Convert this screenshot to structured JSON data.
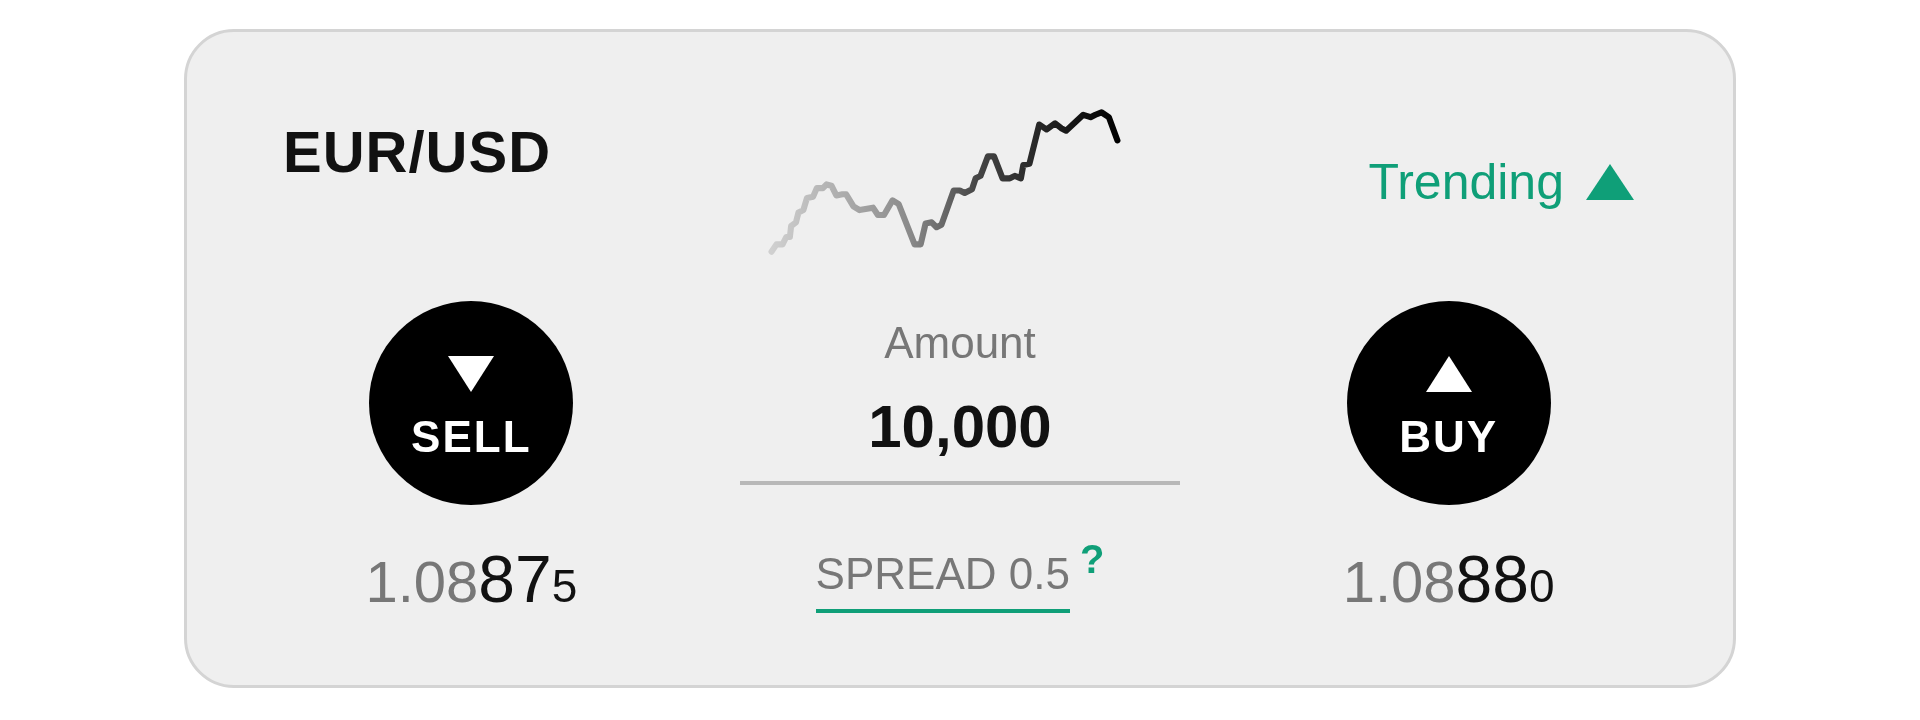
{
  "instrument": {
    "pair": "EUR/USD"
  },
  "trend": {
    "label": "Trending",
    "rising": true
  },
  "sell": {
    "label": "SELL",
    "price": {
      "lead": "1.08",
      "pips": "87",
      "fraction": "5"
    }
  },
  "amount": {
    "label": "Amount",
    "value": "10,000"
  },
  "spread": {
    "label": "SPREAD 0.5",
    "help": "?"
  },
  "buy": {
    "label": "BUY",
    "price": {
      "lead": "1.08",
      "pips": "88",
      "fraction": "0"
    }
  }
}
